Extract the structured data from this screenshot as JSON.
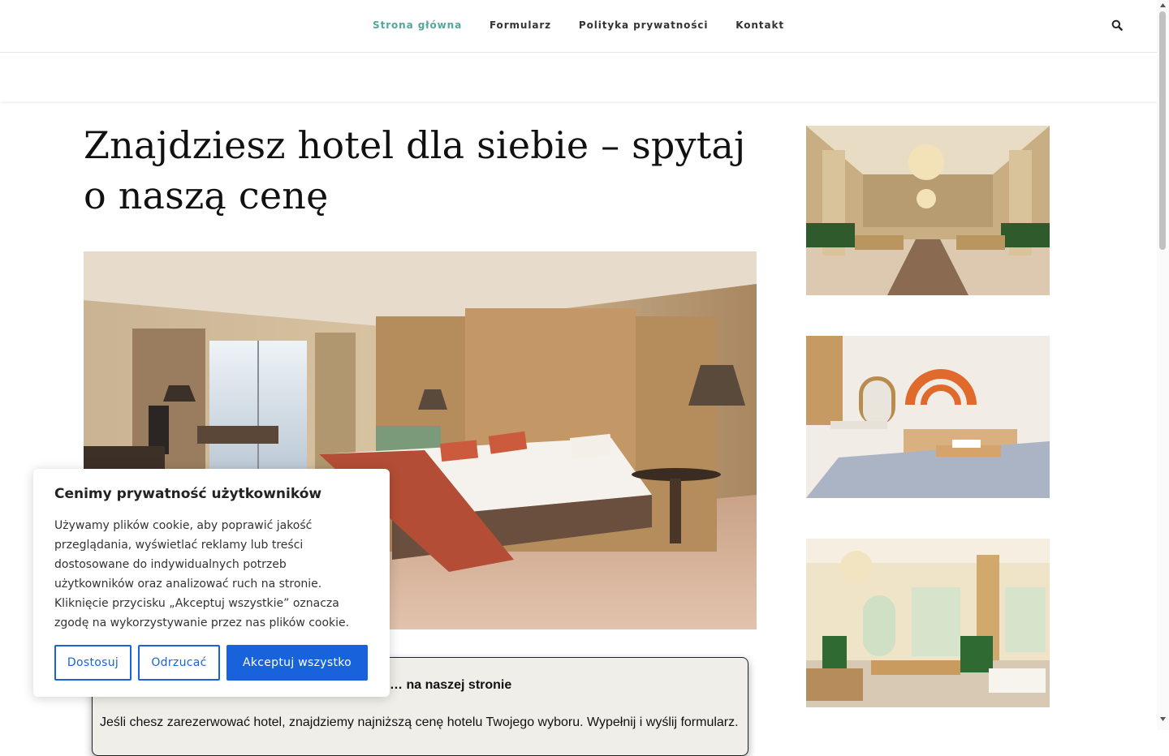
{
  "nav": {
    "items": [
      "Strona główna",
      "Formularz",
      "Polityka prywatności",
      "Kontakt"
    ]
  },
  "article": {
    "title": "Znajdziesz hotel dla siebie – spytaj o naszą cenę"
  },
  "form": {
    "heading": "… na naszej stronie",
    "text": "Jeśli chesz zarezerwować hotel, znajdziemy najniższą cenę hotelu Twojego wyboru. Wypełnij i wyślij formularz."
  },
  "cookie": {
    "title": "Cenimy prywatność użytkowników",
    "text": "Używamy plików cookie, aby poprawić jakość przeglądania, wyświetlać reklamy lub treści dostosowane do indywidualnych potrzeb użytkowników oraz analizować ruch na stronie. Kliknięcie przycisku „Akceptuj wszystkie” oznacza zgodę na wykorzystywanie przez nas plików cookie.",
    "customize_label": "Dostosuj",
    "reject_label": "Odrzucać",
    "accept_label": "Akceptuj wszystko"
  },
  "colors": {
    "accent": "#4fa89b",
    "cookie_button": "#1863dc"
  },
  "icons": [
    "search-icon",
    "scroll-up-arrow-icon",
    "scroll-down-arrow-icon"
  ]
}
